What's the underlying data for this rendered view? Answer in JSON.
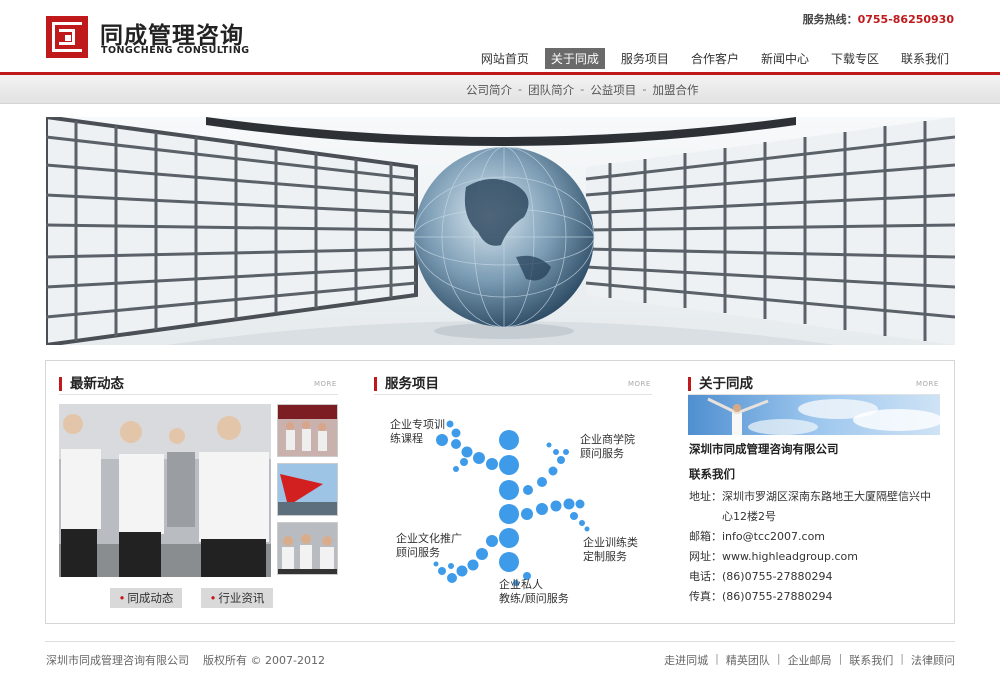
{
  "header": {
    "brand_cn": "同成管理咨询",
    "brand_en": "TONGCHENG CONSULTING",
    "hotline_label": "服务热线：",
    "hotline_number": "0755-86250930",
    "nav": [
      "网站首页",
      "关于同成",
      "服务项目",
      "合作客户",
      "新闻中心",
      "下载专区",
      "联系我们"
    ],
    "nav_active_index": 1
  },
  "subnav": [
    "公司简介",
    "团队简介",
    "公益项目",
    "加盟合作"
  ],
  "subnav_separator": "-",
  "news": {
    "title": "最新动态",
    "more": "MORE",
    "tabs": [
      "同成动态",
      "行业资讯"
    ]
  },
  "services": {
    "title": "服务项目",
    "more": "MORE",
    "items": [
      [
        "企业专项训",
        "练课程"
      ],
      [
        "企业商学院",
        "顾问服务"
      ],
      [
        "企业文化推广",
        "顾问服务"
      ],
      [
        "企业训练类",
        "定制服务"
      ],
      [
        "企业私人",
        "教练/顾问服务"
      ]
    ]
  },
  "about": {
    "title": "关于同成",
    "more": "MORE",
    "company": "深圳市同成管理咨询有限公司",
    "contact_heading": "联系我们",
    "address_label": "地址：",
    "address_line1": "深圳市罗湖区深南东路地王大厦隔壁信兴中",
    "address_line2": "心12楼2号",
    "email_label": "邮箱：",
    "email": "info@tcc2007.com",
    "website_label": "网址：",
    "website": "www.highleadgroup.com",
    "phone_label": "电话：",
    "phone": "(86)0755-27880294",
    "fax_label": "传真：",
    "fax": "(86)0755-27880294"
  },
  "footer": {
    "company": "深圳市同成管理咨询有限公司",
    "copyright": "版权所有 © 2007-2012",
    "links": [
      "走进同城",
      "精英团队",
      "企业邮局",
      "联系我们",
      "法律顾问"
    ],
    "separator": "|"
  },
  "colors": {
    "brand_red": "#c0191c",
    "service_blue": "#3d9be9"
  }
}
